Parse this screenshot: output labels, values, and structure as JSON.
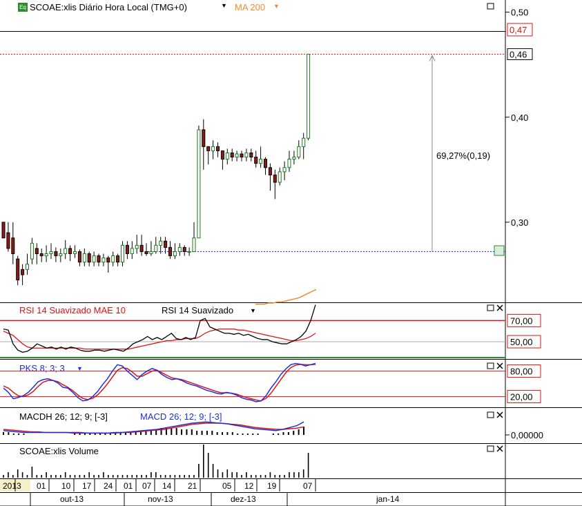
{
  "header": {
    "eq_badge": "Eq",
    "title": "SCOAE:xlis Diário Hora Local (TMG+0)",
    "indicator": "MA 200"
  },
  "colors": {
    "up": "#1a7a1a",
    "down": "#8b1a1a",
    "ma": "#f28c28",
    "rsi": "#e01010",
    "osc_blue": "#1a2ee0",
    "grid": "#000000"
  },
  "price_axis": {
    "ticks": [
      {
        "value": 0.5,
        "label": "0,50"
      },
      {
        "value": 0.4,
        "label": "0,40"
      },
      {
        "value": 0.3,
        "label": "0,30"
      }
    ],
    "range": [
      0.225,
      0.505
    ],
    "current_label": "0,46",
    "current_value": 0.46,
    "high_label": "0,47",
    "high_value": 0.47
  },
  "measure": {
    "label": "69,27%(0,19)",
    "from": 0.272,
    "to": 0.46
  },
  "rsi_panel": {
    "title_a": "RSI 14 Suavizado MAE 10",
    "title_b": "RSI 14 Suavizado",
    "levels": [
      {
        "value": 70,
        "label": "70,00"
      },
      {
        "value": 50,
        "label": "50,00"
      }
    ],
    "range": [
      35,
      82
    ]
  },
  "pks_panel": {
    "title": "PKS 8; 3; 3",
    "levels": [
      {
        "value": 80,
        "label": "80,00"
      },
      {
        "value": 20,
        "label": "20,00"
      }
    ],
    "range": [
      -5,
      102
    ]
  },
  "macd_panel": {
    "title_a": "MACDH 26; 12; 9; [-3]",
    "title_b": "MACD 26; 12; 9; [-3]",
    "zero_label": "0,00000"
  },
  "volume_panel": {
    "title": "SCOAE:xlis Volume"
  },
  "time_axis": {
    "day_labels": [
      "2013",
      "01",
      "10",
      "17",
      "24",
      "01",
      "07",
      "14",
      "21",
      "05",
      "12",
      "19",
      "07"
    ],
    "month_labels": [
      "out-13",
      "nov-13",
      "dez-13",
      "jan-14"
    ]
  },
  "chart_data": {
    "type": "candlestick",
    "ohlc": [
      [
        0.3,
        0.285,
        0.3,
        0.285
      ],
      [
        0.29,
        0.275,
        0.3,
        0.272
      ],
      [
        0.285,
        0.27,
        0.3,
        0.26
      ],
      [
        0.265,
        0.245,
        0.268,
        0.24
      ],
      [
        0.255,
        0.25,
        0.26,
        0.24
      ],
      [
        0.255,
        0.26,
        0.27,
        0.25
      ],
      [
        0.265,
        0.28,
        0.285,
        0.26
      ],
      [
        0.275,
        0.27,
        0.28,
        0.26
      ],
      [
        0.27,
        0.268,
        0.275,
        0.262
      ],
      [
        0.268,
        0.27,
        0.278,
        0.262
      ],
      [
        0.27,
        0.272,
        0.28,
        0.265
      ],
      [
        0.272,
        0.268,
        0.276,
        0.262
      ],
      [
        0.268,
        0.27,
        0.275,
        0.262
      ],
      [
        0.27,
        0.275,
        0.283,
        0.265
      ],
      [
        0.275,
        0.27,
        0.278,
        0.263
      ],
      [
        0.27,
        0.272,
        0.278,
        0.266
      ],
      [
        0.272,
        0.262,
        0.274,
        0.258
      ],
      [
        0.262,
        0.27,
        0.275,
        0.258
      ],
      [
        0.27,
        0.262,
        0.272,
        0.258
      ],
      [
        0.262,
        0.268,
        0.272,
        0.258
      ],
      [
        0.268,
        0.262,
        0.27,
        0.258
      ],
      [
        0.262,
        0.266,
        0.27,
        0.258
      ],
      [
        0.266,
        0.262,
        0.268,
        0.252
      ],
      [
        0.262,
        0.268,
        0.272,
        0.258
      ],
      [
        0.268,
        0.262,
        0.27,
        0.258
      ],
      [
        0.262,
        0.278,
        0.282,
        0.258
      ],
      [
        0.278,
        0.27,
        0.282,
        0.265
      ],
      [
        0.27,
        0.275,
        0.282,
        0.265
      ],
      [
        0.275,
        0.278,
        0.288,
        0.27
      ],
      [
        0.278,
        0.272,
        0.288,
        0.268
      ],
      [
        0.272,
        0.27,
        0.28,
        0.268
      ],
      [
        0.27,
        0.272,
        0.282,
        0.268
      ],
      [
        0.272,
        0.278,
        0.286,
        0.27
      ],
      [
        0.278,
        0.282,
        0.286,
        0.27
      ],
      [
        0.282,
        0.276,
        0.286,
        0.27
      ],
      [
        0.276,
        0.268,
        0.282,
        0.265
      ],
      [
        0.268,
        0.272,
        0.28,
        0.265
      ],
      [
        0.272,
        0.276,
        0.28,
        0.268
      ],
      [
        0.276,
        0.272,
        0.278,
        0.268
      ],
      [
        0.272,
        0.272,
        0.276,
        0.268
      ],
      [
        0.272,
        0.285,
        0.3,
        0.272
      ],
      [
        0.285,
        0.388,
        0.392,
        0.34
      ],
      [
        0.388,
        0.372,
        0.398,
        0.35
      ],
      [
        0.372,
        0.368,
        0.372,
        0.355
      ],
      [
        0.368,
        0.372,
        0.378,
        0.36
      ],
      [
        0.372,
        0.368,
        0.376,
        0.362
      ],
      [
        0.368,
        0.36,
        0.368,
        0.35
      ],
      [
        0.36,
        0.366,
        0.37,
        0.355
      ],
      [
        0.366,
        0.362,
        0.37,
        0.358
      ],
      [
        0.362,
        0.365,
        0.368,
        0.358
      ],
      [
        0.365,
        0.362,
        0.368,
        0.358
      ],
      [
        0.362,
        0.366,
        0.37,
        0.358
      ],
      [
        0.366,
        0.362,
        0.37,
        0.358
      ],
      [
        0.362,
        0.356,
        0.368,
        0.352
      ],
      [
        0.356,
        0.36,
        0.372,
        0.352
      ],
      [
        0.36,
        0.352,
        0.362,
        0.345
      ],
      [
        0.352,
        0.345,
        0.356,
        0.33
      ],
      [
        0.345,
        0.338,
        0.35,
        0.322
      ],
      [
        0.338,
        0.348,
        0.352,
        0.335
      ],
      [
        0.348,
        0.352,
        0.358,
        0.34
      ],
      [
        0.352,
        0.36,
        0.368,
        0.348
      ],
      [
        0.36,
        0.362,
        0.368,
        0.355
      ],
      [
        0.362,
        0.372,
        0.378,
        0.36
      ],
      [
        0.372,
        0.38,
        0.385,
        0.36
      ],
      [
        0.38,
        0.46,
        0.46,
        0.378
      ]
    ],
    "ma200": [
      0.222,
      0.222,
      0.222,
      0.223,
      0.223,
      0.224,
      0.224,
      0.225,
      0.226,
      0.227,
      0.228,
      0.23,
      0.232,
      0.234,
      0.236
    ],
    "rsi_smoothed": [
      62,
      61,
      48,
      42,
      40,
      41,
      44,
      48,
      46,
      44,
      45,
      43,
      45,
      43,
      45,
      44,
      42,
      41,
      41,
      42,
      42,
      41,
      42,
      43,
      42,
      41,
      44,
      48,
      50,
      52,
      55,
      52,
      54,
      52,
      55,
      58,
      53,
      52,
      54,
      52,
      54,
      70,
      72,
      64,
      62,
      60,
      58,
      58,
      57,
      58,
      56,
      57,
      55,
      53,
      52,
      52,
      50,
      49,
      48,
      48,
      50,
      52,
      55,
      60,
      70,
      85
    ],
    "rsi_ma": [
      60,
      58,
      56,
      52,
      48,
      45,
      44,
      44,
      44,
      44,
      44,
      44,
      44,
      44,
      44,
      44,
      44,
      43,
      43,
      43,
      43,
      43,
      43,
      43,
      43,
      43,
      43,
      44,
      45,
      46,
      47,
      48,
      49,
      50,
      51,
      51,
      52,
      52,
      53,
      53,
      53,
      55,
      58,
      60,
      61,
      62,
      62,
      62,
      62,
      61,
      61,
      60,
      59,
      58,
      57,
      56,
      55,
      54,
      53,
      52,
      51,
      51,
      52,
      53,
      55,
      58
    ],
    "pks_fast": [
      40,
      30,
      15,
      18,
      22,
      30,
      42,
      55,
      60,
      62,
      58,
      52,
      42,
      40,
      30,
      18,
      10,
      12,
      20,
      32,
      48,
      62,
      80,
      95,
      92,
      80,
      70,
      60,
      72,
      80,
      86,
      82,
      72,
      65,
      60,
      62,
      58,
      52,
      48,
      45,
      40,
      35,
      32,
      28,
      26,
      30,
      28,
      24,
      18,
      14,
      12,
      8,
      10,
      22,
      40,
      55,
      72,
      85,
      95,
      98,
      96,
      92,
      95,
      98
    ],
    "pks_slow": [
      45,
      40,
      30,
      22,
      20,
      24,
      32,
      44,
      54,
      58,
      58,
      55,
      48,
      42,
      34,
      24,
      16,
      13,
      16,
      24,
      36,
      50,
      66,
      82,
      88,
      86,
      78,
      68,
      68,
      74,
      80,
      82,
      76,
      70,
      64,
      62,
      60,
      56,
      52,
      48,
      44,
      40,
      36,
      32,
      29,
      29,
      28,
      26,
      22,
      18,
      15,
      12,
      10,
      16,
      28,
      44,
      60,
      76,
      88,
      94,
      96,
      95,
      95,
      96
    ],
    "macd_hist": [
      2,
      2,
      1,
      1,
      1,
      0,
      0,
      0,
      0,
      0,
      0,
      0,
      0,
      0,
      1,
      1,
      1,
      1,
      1,
      1,
      1,
      1,
      2,
      2,
      2,
      2,
      2,
      3,
      3,
      4,
      4,
      5,
      5,
      5,
      5,
      4,
      4,
      4,
      3,
      3,
      3,
      3,
      2,
      2,
      2,
      2,
      1,
      1,
      1,
      1,
      1,
      0,
      0,
      1,
      1,
      2,
      2,
      3,
      4,
      6
    ],
    "macd_line": [
      -0.2,
      -0.3,
      -0.4,
      -0.5,
      -0.5,
      -0.5,
      -0.5,
      -0.5,
      -0.5,
      -0.5,
      -0.6,
      -0.6,
      -0.6,
      -0.6,
      -0.6,
      -0.6,
      -0.5,
      -0.5,
      -0.4,
      -0.3,
      -0.2,
      -0.1,
      0.0,
      0.2,
      0.4,
      0.6,
      0.8,
      1.0,
      1.1,
      1.2,
      1.1,
      1.0,
      0.9,
      0.7,
      0.5,
      0.3,
      0.1,
      0.0,
      -0.1,
      -0.2,
      0.0,
      0.3,
      0.6,
      1.2
    ],
    "macd_signal": [
      0.0,
      -0.1,
      -0.2,
      -0.3,
      -0.4,
      -0.4,
      -0.5,
      -0.5,
      -0.5,
      -0.5,
      -0.5,
      -0.5,
      -0.6,
      -0.6,
      -0.6,
      -0.6,
      -0.6,
      -0.5,
      -0.5,
      -0.4,
      -0.3,
      -0.2,
      -0.1,
      0.0,
      0.2,
      0.4,
      0.6,
      0.8,
      0.9,
      1.0,
      1.0,
      1.0,
      0.9,
      0.8,
      0.7,
      0.5,
      0.3,
      0.2,
      0.1,
      0.0,
      0.0,
      0.1,
      0.2,
      0.4
    ],
    "volume": [
      1,
      2,
      1,
      3,
      2,
      1,
      4,
      1,
      1,
      2,
      1,
      1,
      1,
      2,
      1,
      1,
      1,
      1,
      2,
      1,
      1,
      2,
      1,
      1,
      1,
      1,
      1,
      1,
      1,
      1,
      1,
      2,
      2,
      1,
      1,
      1,
      1,
      1,
      1,
      1,
      1,
      5,
      12,
      9,
      5,
      3,
      2,
      3,
      2,
      2,
      1,
      2,
      1,
      1,
      1,
      1,
      2,
      1,
      1,
      1,
      2,
      2,
      2,
      3,
      9
    ]
  }
}
